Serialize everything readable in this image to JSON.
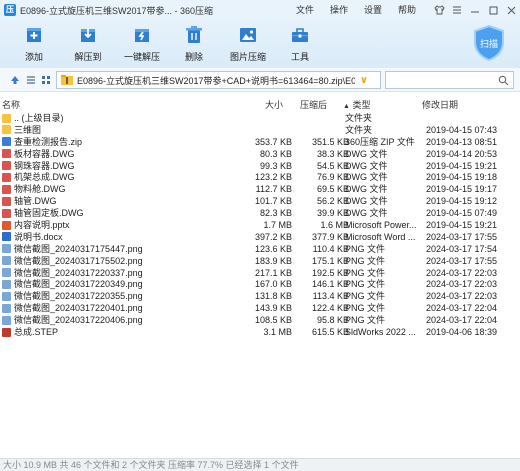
{
  "window": {
    "title": "E0896-立式旋压机三维SW2017带参...  - 360压缩",
    "menu": [
      "文件",
      "操作",
      "设置",
      "帮助"
    ]
  },
  "toolbar": {
    "add": "添加",
    "extract_to": "解压到",
    "one_click_extract": "一键解压",
    "delete": "删除",
    "image_compress": "图片压缩",
    "tools": "工具",
    "scan": "扫描"
  },
  "address": {
    "path": "E0896-立式旋压机三维SW2017带参+CAD+说明书=613464=80.zip\\E089",
    "search_placeholder": ""
  },
  "columns": {
    "name": "名称",
    "size": "大小",
    "packed": "压缩后",
    "type": "类型",
    "modified": "修改日期"
  },
  "files": [
    {
      "name": ".. (上级目录)",
      "size": "",
      "packed": "",
      "type": "文件夹",
      "date": "",
      "icon": "folder-up"
    },
    {
      "name": "三维图",
      "size": "",
      "packed": "",
      "type": "文件夹",
      "date": "2019-04-15 07:43",
      "icon": "folder"
    },
    {
      "name": "查重检测报告.zip",
      "size": "353.7 KB",
      "packed": "351.5 KB",
      "type": "360压缩 ZIP 文件",
      "date": "2019-04-13 08:51",
      "icon": "zip"
    },
    {
      "name": "板材容器.DWG",
      "size": "80.3 KB",
      "packed": "38.3 KB",
      "type": "DWG 文件",
      "date": "2019-04-14 20:53",
      "icon": "dwg"
    },
    {
      "name": "钢珠容器.DWG",
      "size": "99.3 KB",
      "packed": "54.5 KB",
      "type": "DWG 文件",
      "date": "2019-04-15 19:21",
      "icon": "dwg"
    },
    {
      "name": "机架总成.DWG",
      "size": "123.2 KB",
      "packed": "76.9 KB",
      "type": "DWG 文件",
      "date": "2019-04-15 19:18",
      "icon": "dwg"
    },
    {
      "name": "物料舱.DWG",
      "size": "112.7 KB",
      "packed": "69.5 KB",
      "type": "DWG 文件",
      "date": "2019-04-15 19:17",
      "icon": "dwg"
    },
    {
      "name": "轴管.DWG",
      "size": "101.7 KB",
      "packed": "56.2 KB",
      "type": "DWG 文件",
      "date": "2019-04-15 19:12",
      "icon": "dwg"
    },
    {
      "name": "轴管固定板.DWG",
      "size": "82.3 KB",
      "packed": "39.9 KB",
      "type": "DWG 文件",
      "date": "2019-04-15 07:49",
      "icon": "dwg"
    },
    {
      "name": "内容说明.pptx",
      "size": "1.7 MB",
      "packed": "1.6 MB",
      "type": "Microsoft Power...",
      "date": "2019-04-15 19:21",
      "icon": "pptx"
    },
    {
      "name": "说明书.docx",
      "size": "397.2 KB",
      "packed": "377.9 KB",
      "type": "Microsoft Word ...",
      "date": "2024-03-17 17:55",
      "icon": "docx"
    },
    {
      "name": "微信截图_20240317175447.png",
      "size": "123.6 KB",
      "packed": "110.4 KB",
      "type": "PNG 文件",
      "date": "2024-03-17 17:54",
      "icon": "png"
    },
    {
      "name": "微信截图_20240317175502.png",
      "size": "183.9 KB",
      "packed": "175.1 KB",
      "type": "PNG 文件",
      "date": "2024-03-17 17:55",
      "icon": "png"
    },
    {
      "name": "微信截图_20240317220337.png",
      "size": "217.1 KB",
      "packed": "192.5 KB",
      "type": "PNG 文件",
      "date": "2024-03-17 22:03",
      "icon": "png"
    },
    {
      "name": "微信截图_20240317220349.png",
      "size": "167.0 KB",
      "packed": "146.1 KB",
      "type": "PNG 文件",
      "date": "2024-03-17 22:03",
      "icon": "png"
    },
    {
      "name": "微信截图_20240317220355.png",
      "size": "131.8 KB",
      "packed": "113.4 KB",
      "type": "PNG 文件",
      "date": "2024-03-17 22:03",
      "icon": "png"
    },
    {
      "name": "微信截图_20240317220401.png",
      "size": "143.9 KB",
      "packed": "122.4 KB",
      "type": "PNG 文件",
      "date": "2024-03-17 22:04",
      "icon": "png"
    },
    {
      "name": "微信截图_20240317220406.png",
      "size": "108.5 KB",
      "packed": "95.8 KB",
      "type": "PNG 文件",
      "date": "2024-03-17 22:04",
      "icon": "png"
    },
    {
      "name": "总成.STEP",
      "size": "3.1 MB",
      "packed": "615.5 KB",
      "type": "SldWorks 2022 ...",
      "date": "2019-04-06 18:39",
      "icon": "step"
    }
  ],
  "status": "大小 10.9 MB 共 46 个文件和 2 个文件夹 压缩率 77.7% 已经选择 1 个文件",
  "colors": {
    "accent": "#1e88e5",
    "folder": "#f5c342",
    "dwg": "#d9534f",
    "zip": "#3b7dd8",
    "png": "#7aa7d8"
  }
}
